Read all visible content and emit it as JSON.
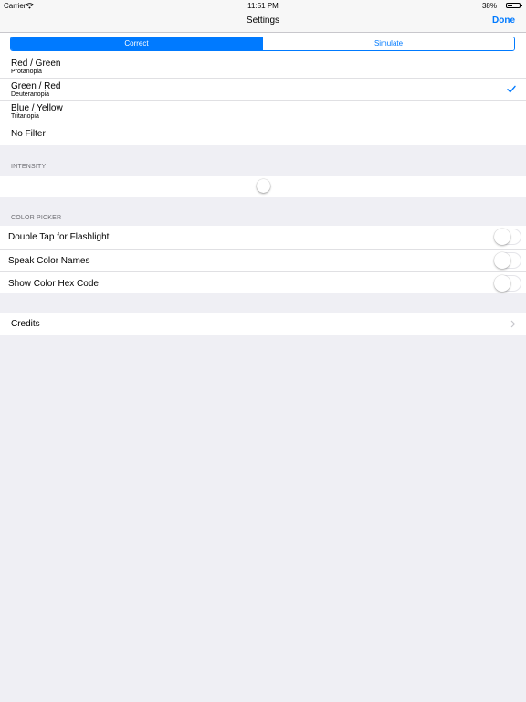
{
  "status_bar": {
    "carrier": "Carrier",
    "time": "11:51 PM",
    "battery": "38%"
  },
  "nav": {
    "title": "Settings",
    "done_label": "Done"
  },
  "mode_segment": {
    "options": [
      "Correct",
      "Simulate"
    ],
    "selected": "Correct"
  },
  "filters": [
    {
      "title": "Red / Green",
      "subtitle": "Protanopia",
      "checked": false
    },
    {
      "title": "Green / Red",
      "subtitle": "Deuteranopia",
      "checked": true
    },
    {
      "title": "Blue / Yellow",
      "subtitle": "Tritanopia",
      "checked": false
    },
    {
      "title": "No Filter",
      "checked": false
    }
  ],
  "intensity": {
    "header": "INTENSITY",
    "value": 0.5
  },
  "color_picker": {
    "header": "COLOR PICKER",
    "toggles": [
      {
        "label": "Double Tap for Flashlight",
        "on": false
      },
      {
        "label": "Speak Color Names",
        "on": false
      },
      {
        "label": "Show Color Hex Code",
        "on": false
      }
    ]
  },
  "credits": {
    "label": "Credits"
  },
  "colors": {
    "accent": "#007aff",
    "background": "#efeff4",
    "separator": "#e0e0e3"
  }
}
